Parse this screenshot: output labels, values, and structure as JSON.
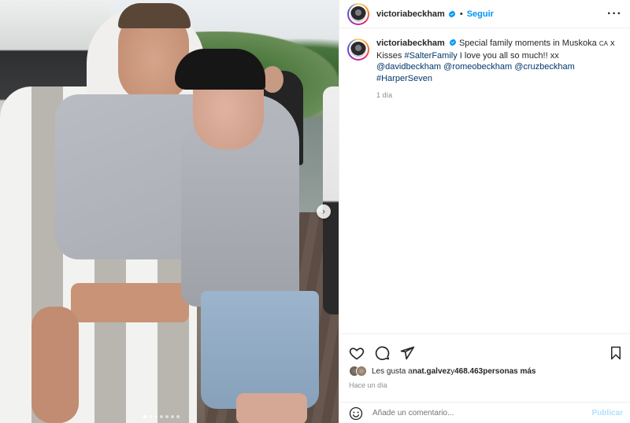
{
  "post": {
    "carousel": {
      "slide_count": 7,
      "active_index": 0
    }
  },
  "header": {
    "username": "victoriabeckham",
    "separator": "•",
    "follow_label": "Seguir",
    "more_label": "···"
  },
  "caption": {
    "username": "victoriabeckham",
    "text_1": " Special family moments in Muskoka ",
    "flag": "CA",
    "text_2": " x Kisses ",
    "hashtag_1": "#SalterFamily",
    "text_3": " I love you all so much!! xx ",
    "mention_1": "@davidbeckham",
    "mention_2": "@romeobeckham",
    "mention_3": "@cruzbeckham",
    "hashtag_2": "#HarperSeven",
    "time": "1 día"
  },
  "likes": {
    "prefix": "Les gusta a ",
    "user": "nat.galvez",
    "middle": " y ",
    "count": "468.463",
    "suffix": " personas más"
  },
  "post_date": "Hace un día",
  "comment": {
    "placeholder": "Añade un comentario...",
    "publish_label": "Publicar"
  },
  "colors": {
    "link_blue": "#0095f6",
    "hashtag_blue": "#00376b",
    "muted": "#8e8e8e"
  }
}
